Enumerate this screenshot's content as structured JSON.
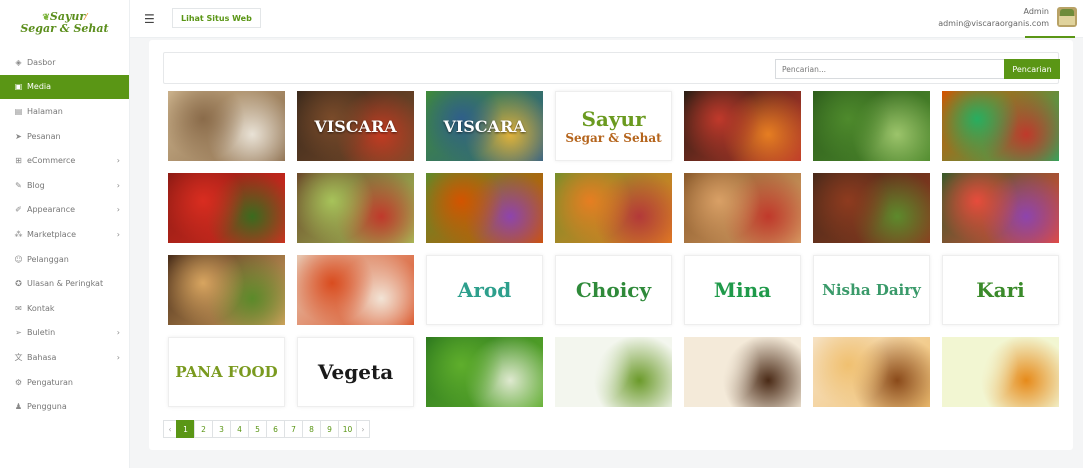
{
  "brand": {
    "line1": "Sayur",
    "line2": "Segar & Sehat"
  },
  "sidebar": {
    "items": [
      {
        "label": "Dasbor",
        "icon": "dashboard-icon",
        "glyph": "◈",
        "active": false,
        "chevron": false
      },
      {
        "label": "Media",
        "icon": "image-icon",
        "glyph": "▣",
        "active": true,
        "chevron": false
      },
      {
        "label": "Halaman",
        "icon": "pages-icon",
        "glyph": "▤",
        "active": false,
        "chevron": false
      },
      {
        "label": "Pesanan",
        "icon": "send-icon",
        "glyph": "➤",
        "active": false,
        "chevron": false
      },
      {
        "label": "eCommerce",
        "icon": "cart-icon",
        "glyph": "⊞",
        "active": false,
        "chevron": true
      },
      {
        "label": "Blog",
        "icon": "edit-icon",
        "glyph": "✎",
        "active": false,
        "chevron": true
      },
      {
        "label": "Appearance",
        "icon": "brush-icon",
        "glyph": "✐",
        "active": false,
        "chevron": true
      },
      {
        "label": "Marketplace",
        "icon": "marketplace-icon",
        "glyph": "⁂",
        "active": false,
        "chevron": true
      },
      {
        "label": "Pelanggan",
        "icon": "customers-icon",
        "glyph": "☺",
        "active": false,
        "chevron": false
      },
      {
        "label": "Ulasan & Peringkat",
        "icon": "reviews-icon",
        "glyph": "✪",
        "active": false,
        "chevron": false
      },
      {
        "label": "Kontak",
        "icon": "mail-icon",
        "glyph": "✉",
        "active": false,
        "chevron": false
      },
      {
        "label": "Buletin",
        "icon": "newsletter-icon",
        "glyph": "➢",
        "active": false,
        "chevron": true
      },
      {
        "label": "Bahasa",
        "icon": "language-icon",
        "glyph": "文",
        "active": false,
        "chevron": true
      },
      {
        "label": "Pengaturan",
        "icon": "settings-icon",
        "glyph": "⚙",
        "active": false,
        "chevron": false
      },
      {
        "label": "Pengguna",
        "icon": "users-icon",
        "glyph": "♟",
        "active": false,
        "chevron": false
      }
    ]
  },
  "topbar": {
    "menu_icon": "hamburger-icon",
    "visit_site_label": "Lihat Situs Web",
    "user_name": "Admin",
    "user_email": "admin@viscaraorganis.com"
  },
  "search": {
    "placeholder": "Pencarian...",
    "button_label": "Pencarian"
  },
  "media": [
    {
      "name": "store-building-image",
      "type": "scene",
      "colors": [
        "#c9b08a",
        "#8a6b4a",
        "#e9e2d6"
      ]
    },
    {
      "name": "viscara-sign-image",
      "type": "scene",
      "colors": [
        "#3b2a1c",
        "#7a4b2a",
        "#c23b22"
      ],
      "text": "VISCARA"
    },
    {
      "name": "viscara-organis-store-image",
      "type": "scene",
      "colors": [
        "#3f8a3a",
        "#2f5f8a",
        "#e0b23a"
      ],
      "text": "VISCARA"
    },
    {
      "name": "sayur-logo-image",
      "type": "logo",
      "text": "Sayur",
      "text2": "Segar & Sehat",
      "color": "#6a9a1f"
    },
    {
      "name": "mixed-vegetables-dark-image",
      "type": "scene",
      "colors": [
        "#2b1e14",
        "#c0392b",
        "#e67e22"
      ]
    },
    {
      "name": "spinach-leaves-image",
      "type": "scene",
      "colors": [
        "#2e5e1c",
        "#4e8a2c",
        "#9cc46b"
      ]
    },
    {
      "name": "vegetable-assortment-image",
      "type": "scene",
      "colors": [
        "#d35400",
        "#27ae60",
        "#c0392b"
      ]
    },
    {
      "name": "red-chilies-image",
      "type": "scene",
      "colors": [
        "#8e1b14",
        "#d92d20",
        "#3a6b1e"
      ]
    },
    {
      "name": "vegetable-basket-image",
      "type": "scene",
      "colors": [
        "#6b4a2a",
        "#a7c35a",
        "#c0392b"
      ]
    },
    {
      "name": "salad-bowls-image",
      "type": "scene",
      "colors": [
        "#5f8a2a",
        "#d35400",
        "#8e44ad"
      ]
    },
    {
      "name": "fruits-kiwi-mango-image",
      "type": "scene",
      "colors": [
        "#7a8e2a",
        "#e67e22",
        "#b33939"
      ]
    },
    {
      "name": "pizza-image",
      "type": "scene",
      "colors": [
        "#8a5a2b",
        "#d9a066",
        "#c0392b"
      ]
    },
    {
      "name": "grilled-steak-image",
      "type": "scene",
      "colors": [
        "#4a2a1a",
        "#8e3b1f",
        "#5d8a2c"
      ]
    },
    {
      "name": "vegetable-platter-image",
      "type": "scene",
      "colors": [
        "#3a5a2a",
        "#e74c3c",
        "#8e44ad"
      ]
    },
    {
      "name": "pasta-nests-image",
      "type": "scene",
      "colors": [
        "#4a2e1a",
        "#d8a560",
        "#5b8a2a"
      ]
    },
    {
      "name": "tomatoes-hands-image",
      "type": "scene",
      "colors": [
        "#e7c6b0",
        "#d94c1f",
        "#f2e4d6"
      ]
    },
    {
      "name": "arod-logo-image",
      "type": "logo",
      "text": "Arod",
      "color": "#2d9f8c"
    },
    {
      "name": "choicy-logo-image",
      "type": "logo",
      "text": "Choicy",
      "color": "#2f8a3a"
    },
    {
      "name": "mina-logo-image",
      "type": "logo",
      "text": "Mina",
      "color": "#1f9a4a"
    },
    {
      "name": "nisha-dairy-logo-image",
      "type": "logo",
      "text": "Nisha Dairy",
      "color": "#3a9a6a"
    },
    {
      "name": "kari-logo-image",
      "type": "logo",
      "text": "Kari",
      "color": "#3a8a2a"
    },
    {
      "name": "pana-food-logo-image",
      "type": "logo",
      "text": "PANA FOOD",
      "color": "#7a9a1f"
    },
    {
      "name": "vegeta-logo-image",
      "type": "logo",
      "text": "Vegeta",
      "color": "#1a1a1a"
    },
    {
      "name": "limes-image",
      "type": "scene",
      "colors": [
        "#2e7a1e",
        "#5fae2c",
        "#dfe9d0"
      ]
    },
    {
      "name": "vegetables-white-bg-image",
      "type": "scene",
      "colors": [
        "#f3f6ee",
        "#f3f6ee",
        "#6b9a2a"
      ]
    },
    {
      "name": "coffee-beans-image",
      "type": "scene",
      "colors": [
        "#f4ead9",
        "#f4ead9",
        "#4a2a16"
      ]
    },
    {
      "name": "burger-image",
      "type": "scene",
      "colors": [
        "#f6e2c4",
        "#f0c070",
        "#8a4a1a"
      ]
    },
    {
      "name": "juice-splash-image",
      "type": "scene",
      "colors": [
        "#f2f6d2",
        "#f2f6d2",
        "#e68a1a"
      ]
    }
  ],
  "pagination": {
    "prev_label": "‹",
    "next_label": "›",
    "pages": [
      "1",
      "2",
      "3",
      "4",
      "5",
      "6",
      "7",
      "8",
      "9",
      "10"
    ],
    "current": "1"
  }
}
